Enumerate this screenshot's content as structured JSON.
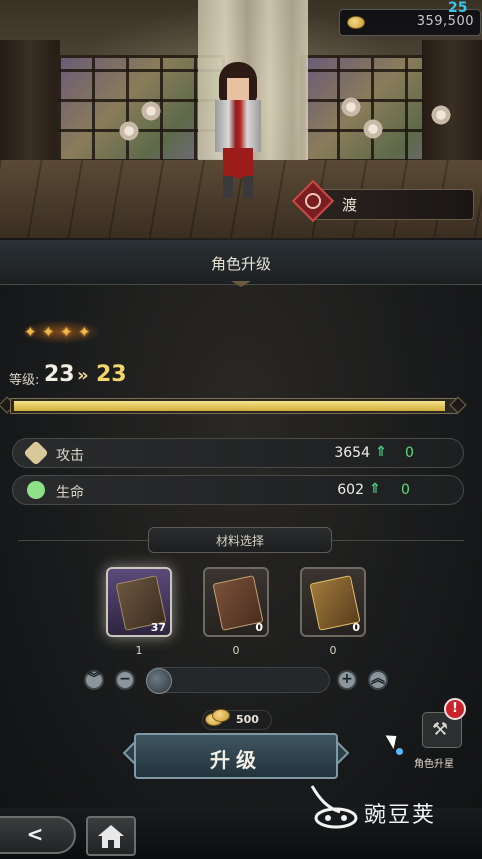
{
  "header": {
    "currency": {
      "icon": "gold-coin-icon",
      "value": "359,500"
    },
    "badge": "25"
  },
  "character": {
    "name": "渡",
    "element_icon": "fire-element-icon",
    "stars": 4
  },
  "panel": {
    "title": "角色升级",
    "level": {
      "label": "等级:",
      "current": "23",
      "arrow": "»",
      "next": "23"
    },
    "exp_progress": 0.98,
    "stats": [
      {
        "icon": "attack-icon",
        "label": "攻击",
        "value": "3654",
        "delta": "0"
      },
      {
        "icon": "hp-icon",
        "label": "生命",
        "value": "602",
        "delta": "0"
      }
    ],
    "materials": {
      "title": "材料选择",
      "items": [
        {
          "icon": "purple-exp-book-icon",
          "count": "37",
          "selected": "1"
        },
        {
          "icon": "brown-exp-book-icon",
          "count": "0",
          "selected": "0"
        },
        {
          "icon": "gold-exp-book-icon",
          "count": "0",
          "selected": "0"
        }
      ]
    },
    "slider": {
      "value": 0
    },
    "cost": "500",
    "upgrade_button": "升级",
    "side_button": {
      "label": "角色升星",
      "alert": "!"
    }
  },
  "watermark": "豌豆荚",
  "nav": {
    "back": "<",
    "home": "home-icon"
  },
  "colors": {
    "accent_gold": "#f4d56a",
    "stat_up_green": "#4ad28a",
    "alert_red": "#c8242a"
  }
}
